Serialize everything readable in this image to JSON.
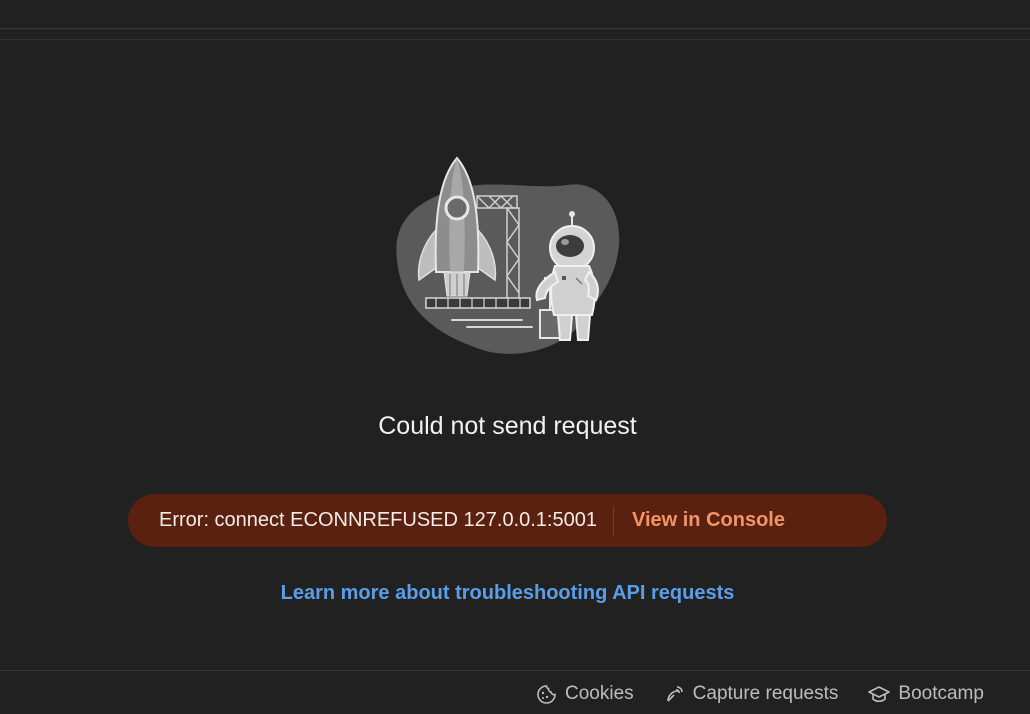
{
  "main": {
    "headline": "Could not send request",
    "error": {
      "message": "Error: connect ECONNREFUSED 127.0.0.1:5001",
      "action_label": "View in Console"
    },
    "help_link": "Learn more about troubleshooting API requests"
  },
  "status_bar": {
    "items": [
      {
        "label": "Cookies",
        "icon": "cookie-icon"
      },
      {
        "label": "Capture requests",
        "icon": "satellite-icon"
      },
      {
        "label": "Bootcamp",
        "icon": "graduation-cap-icon"
      }
    ]
  },
  "colors": {
    "background": "#212121",
    "error_banner": "#5a2010",
    "error_action": "#f29467",
    "link": "#5b9ee8"
  }
}
